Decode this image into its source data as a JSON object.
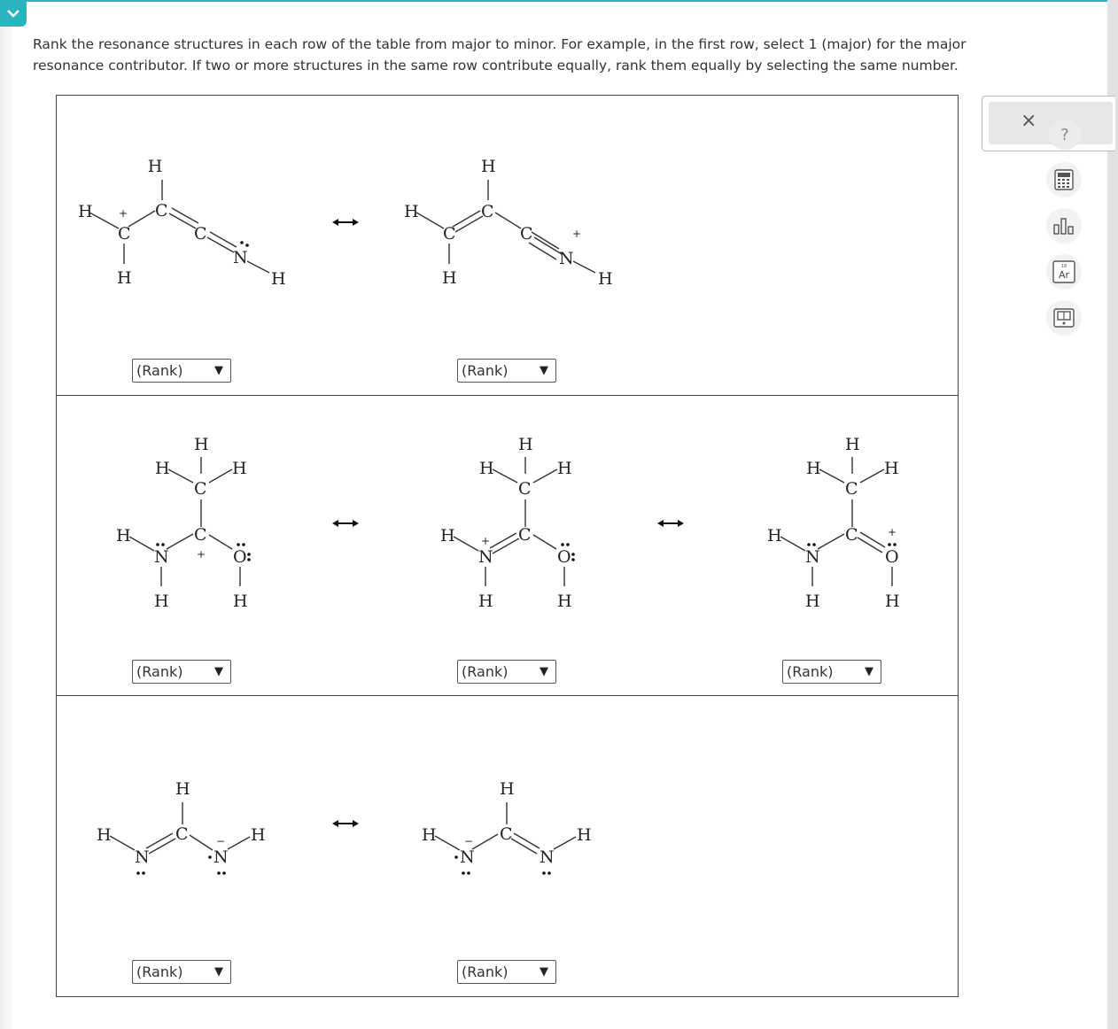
{
  "instructions": {
    "line1": "Rank the resonance structures in each row of the table from major to minor. For example, in the first row, select 1 (major) for the major",
    "line2": "resonance contributor. If two or more structures in the same row contribute equally, rank them equally by selecting the same number."
  },
  "dropdowns": {
    "r1s1": "(Rank)",
    "r1s2": "(Rank)",
    "r2s1": "(Rank)",
    "r2s2": "(Rank)",
    "r2s3": "(Rank)",
    "r3s1": "(Rank)",
    "r3s2": "(Rank)"
  },
  "atoms": {
    "H": "H",
    "C": "C",
    "N": "N",
    "O": "O"
  },
  "charges": {
    "plus": "+",
    "minus": "−"
  },
  "tools": {
    "close": "×",
    "help": "?",
    "calculator_icon": "calculator-icon",
    "chart_icon": "bar-chart-icon",
    "periodic_table_icon": "periodic-table-icon",
    "periodic_table_label": "Ar",
    "periodic_table_number": "18",
    "reference_icon": "data-reference-icon"
  },
  "colors": {
    "accent": "#2bb3c0",
    "border": "#444444"
  }
}
